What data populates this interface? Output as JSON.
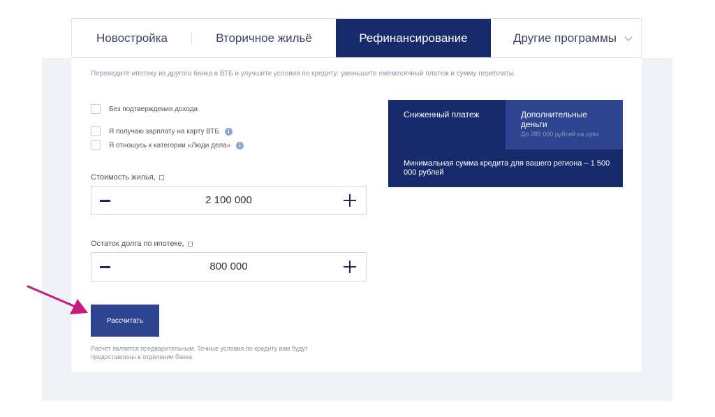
{
  "tabs": [
    {
      "label": "Новостройка",
      "active": false
    },
    {
      "label": "Вторичное жильё",
      "active": false
    },
    {
      "label": "Рефинансирование",
      "active": true
    },
    {
      "label": "Другие программы",
      "active": false
    }
  ],
  "subtitle": "Переведите ипотеку из другого банка в ВТБ и улучшите условия по кредиту: уменьшите ежемесячный платеж и сумму переплаты.",
  "checkboxes": [
    {
      "label": "Без подтверждения дохода",
      "checked": false
    },
    {
      "label": "Я получаю зарплату на карту ВТБ",
      "checked": false
    },
    {
      "label": "Я отношусь к категории «Люди дела»",
      "checked": false
    }
  ],
  "property_cost": {
    "label": "Стоимость жилья,",
    "value": "2 100 000"
  },
  "debt_remaining": {
    "label": "Остаток долга по ипотеке,",
    "value": "800 000"
  },
  "calculate_button": "Рассчитать",
  "note": "Расчет является предварительным. Точные условия по кредиту вам будут предоставлены в отделении банка.",
  "promo": {
    "option1": "Сниженный платеж",
    "option2_title": "Дополнительные деньги",
    "option2_sub": "До 285 000 рублей на руки",
    "text": "Минимальная сумма кредита для вашего региона – 1 500 000 рублей"
  },
  "colors": {
    "brand_dark": "#172a6b",
    "brand": "#2e4491",
    "arrow": "#c8197e"
  },
  "icons": {
    "info": "i",
    "chevron": "chevron-down-icon",
    "minus": "minus-icon",
    "plus": "plus-icon"
  }
}
